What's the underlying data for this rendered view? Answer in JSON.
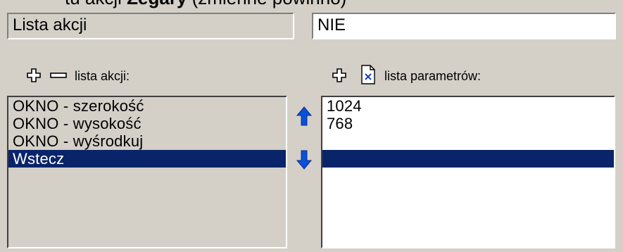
{
  "top_partial_text": {
    "part1": "tu akcji ",
    "part2_bold": "Zegary",
    "part3": " (zmienne powinno)"
  },
  "fields": {
    "action_list_name": "Lista akcji",
    "action_list_value": "NIE"
  },
  "actions_panel": {
    "label": "lista akcji:",
    "items": [
      "OKNO - szerokość",
      "OKNO - wysokość",
      "OKNO - wyśrodkuj",
      "Wstecz",
      ""
    ],
    "selected_index": 3
  },
  "params_panel": {
    "label": "lista parametrów:",
    "items": [
      "1024",
      "768",
      "",
      "",
      ""
    ],
    "selected_index": 3
  },
  "icons": {
    "add": "plus-icon",
    "remove": "minus-icon",
    "delete_param": "delete-document-icon",
    "move_up": "arrow-up-icon",
    "move_down": "arrow-down-icon"
  },
  "colors": {
    "window_bg": "#d4d0c8",
    "selection_bg": "#0a246a",
    "arrow_blue": "#0a50d8"
  }
}
